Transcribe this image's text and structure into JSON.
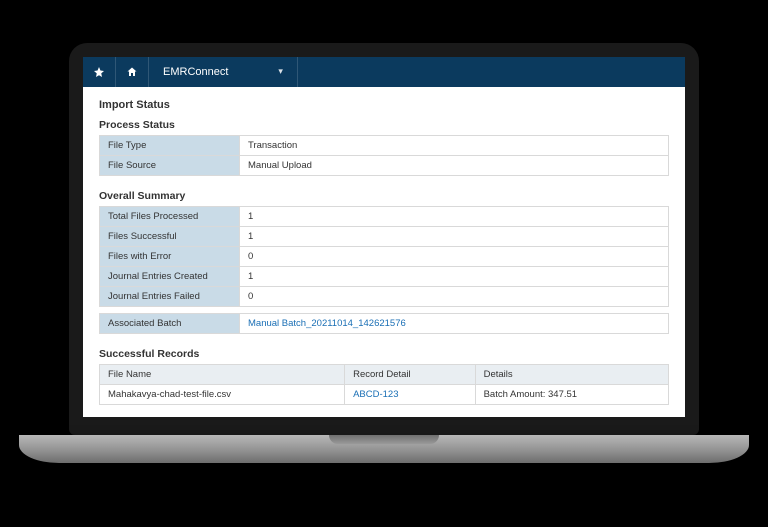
{
  "topbar": {
    "app_name": "EMRConnect"
  },
  "page": {
    "title": "Import Status"
  },
  "process_status": {
    "heading": "Process Status",
    "rows": [
      {
        "label": "File Type",
        "value": "Transaction"
      },
      {
        "label": "File Source",
        "value": "Manual Upload"
      }
    ]
  },
  "overall_summary": {
    "heading": "Overall Summary",
    "rows": [
      {
        "label": "Total Files Processed",
        "value": "1"
      },
      {
        "label": "Files Successful",
        "value": "1"
      },
      {
        "label": "Files with Error",
        "value": "0"
      },
      {
        "label": "Journal Entries Created",
        "value": "1"
      },
      {
        "label": "Journal Entries Failed",
        "value": "0"
      }
    ],
    "associated_batch_label": "Associated Batch",
    "associated_batch_link": "Manual Batch_20211014_142621576"
  },
  "successful_records": {
    "heading": "Successful Records",
    "columns": {
      "file_name": "File Name",
      "record_detail": "Record Detail",
      "details": "Details"
    },
    "rows": [
      {
        "file_name": "Mahakavya-chad-test-file.csv",
        "record_detail": "ABCD-123",
        "details": "Batch Amount: 347.51"
      }
    ]
  }
}
